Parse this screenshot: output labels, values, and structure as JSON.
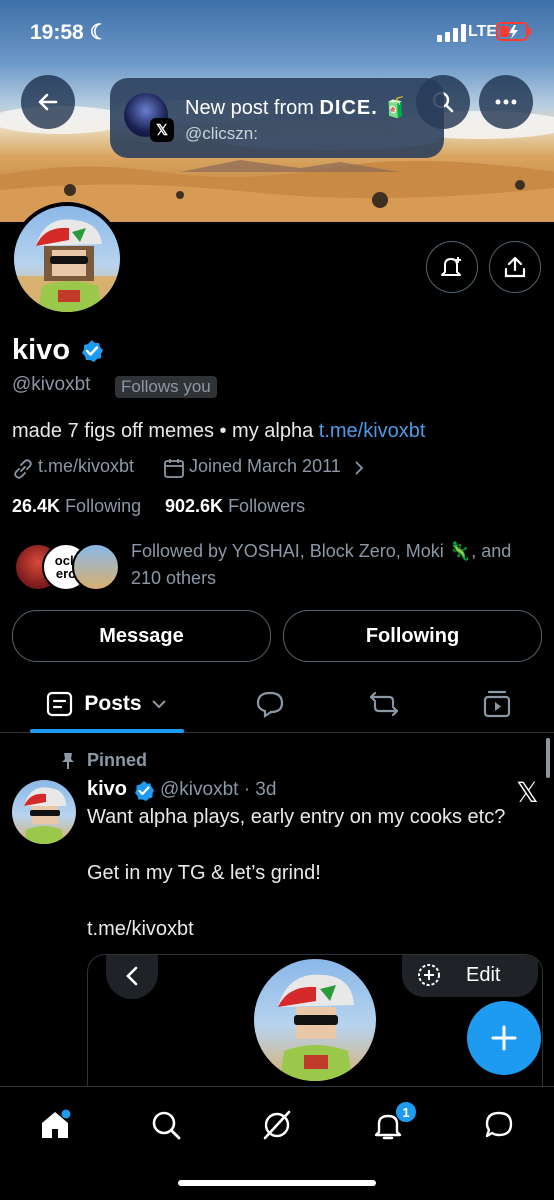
{
  "status": {
    "time": "19:58",
    "network": "LTE"
  },
  "notification": {
    "title_prefix": "New post from ",
    "title_brand": "DICE.",
    "emoji": "🧃",
    "subtitle": "@clicszn:"
  },
  "profile": {
    "name": "kivo",
    "handle": "@kivoxbt",
    "follows_badge": "Follows you",
    "bio_text": "made 7 figs off memes • my alpha ",
    "bio_link": "t.me/kivoxbt",
    "website": "t.me/kivoxbt",
    "joined": "Joined March 2011",
    "following_count": "26.4K",
    "following_label": "Following",
    "followers_count": "902.6K",
    "followers_label": "Followers",
    "followed_by_line1": "Followed by YOSHAI, Block Zero, Moki",
    "followed_by_suffix": ", and",
    "followed_by_line2": "210 others",
    "mini_avatar_text": "ock\nero"
  },
  "actions": {
    "message": "Message",
    "following": "Following"
  },
  "tabs": {
    "posts": "Posts"
  },
  "post": {
    "pinned_label": "Pinned",
    "author": "kivo",
    "handle_time": "@kivoxbt · 3d",
    "line1": "Want alpha plays, early entry on my cooks etc?",
    "line2": "Get in my TG & let’s grind!",
    "link": "t.me/kivoxbt",
    "edit_label": "Edit"
  },
  "nav": {
    "notifications_badge": "1"
  },
  "colors": {
    "accent": "#1d9bf0",
    "link": "#4c9ae8",
    "secondary_text": "#8b98a5",
    "border": "#2f3336"
  }
}
